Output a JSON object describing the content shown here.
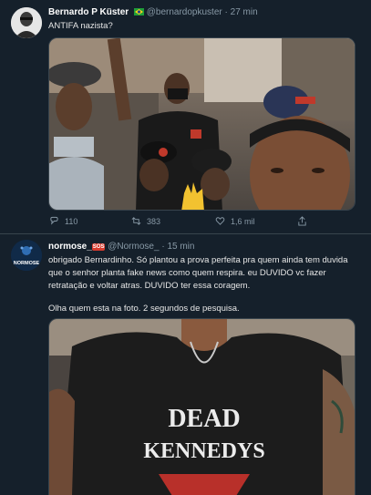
{
  "tweet1": {
    "name": "Bernardo P Küster",
    "handle": "@bernardopkuster",
    "separator": "·",
    "time": "27 min",
    "text": "ANTIFA nazista?",
    "actions": {
      "reply_count": "110",
      "retweet_count": "383",
      "like_count": "1,6 mil"
    }
  },
  "tweet2": {
    "name": "normose_",
    "badge": "SOS",
    "handle": "@Normose_",
    "separator": "·",
    "time": "15 min",
    "avatar_text": "NORMOSE",
    "text_p1": "obrigado Bernardinho. Só plantou a prova perfeita pra quem ainda tem duvida que o senhor planta fake news como quem respira. eu DUVIDO vc fazer retratação e voltar atras. DUVIDO ter essa coragem.",
    "text_p2": "Olha quem esta na foto. 2 segundos de pesquisa.",
    "shirt_text_line1": "DEAD",
    "shirt_text_line2": "KENNEDYS"
  },
  "colors": {
    "background": "#15202b",
    "divider": "#38444d",
    "muted": "#8899a6",
    "name": "#ffffff"
  }
}
